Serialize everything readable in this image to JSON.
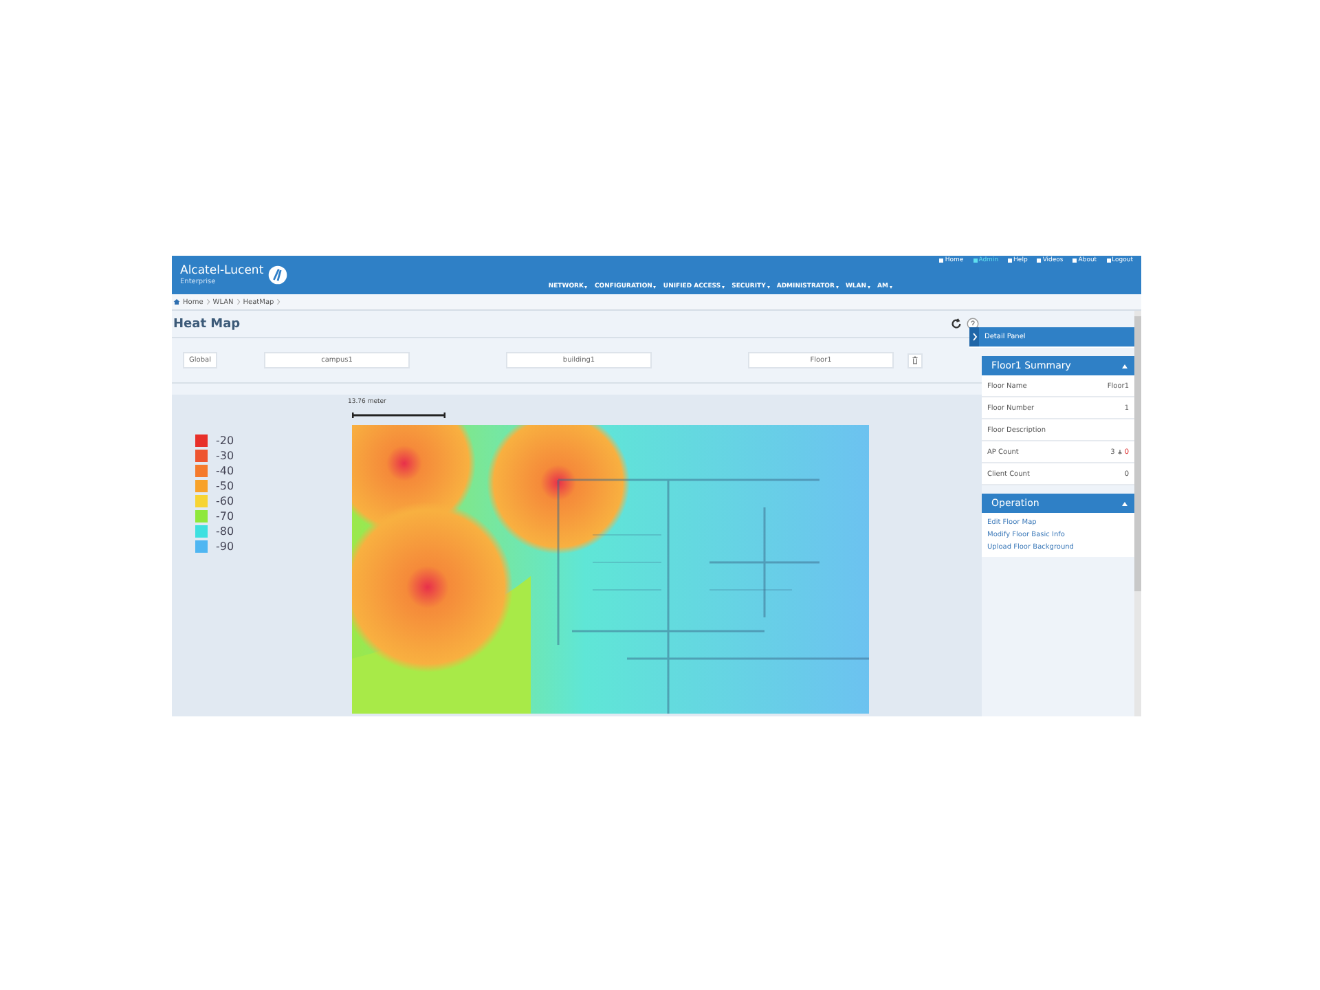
{
  "header": {
    "brand": "Alcatel-Lucent",
    "sub_brand": "Enterprise",
    "top_links": [
      {
        "label": "Home",
        "selected": false
      },
      {
        "label": "Admin",
        "selected": true
      },
      {
        "label": "Help",
        "selected": false
      },
      {
        "label": "Videos",
        "selected": false
      },
      {
        "label": "About",
        "selected": false
      },
      {
        "label": "Logout",
        "selected": false
      }
    ],
    "menu": [
      "NETWORK",
      "CONFIGURATION",
      "UNIFIED ACCESS",
      "SECURITY",
      "ADMINISTRATOR",
      "WLAN",
      "AM"
    ]
  },
  "breadcrumb": [
    "Home",
    "WLAN",
    "HeatMap"
  ],
  "page_title": "Heat Map",
  "filters": {
    "global": "Global",
    "campus": "campus1",
    "building": "building1",
    "floor": "Floor1"
  },
  "scale": {
    "label": "13.76  meter"
  },
  "legend": [
    {
      "label": "-20",
      "color": "#e8302a"
    },
    {
      "label": "-30",
      "color": "#ee5530"
    },
    {
      "label": "-40",
      "color": "#f57a2c"
    },
    {
      "label": "-50",
      "color": "#f8a22a"
    },
    {
      "label": "-60",
      "color": "#f7d433"
    },
    {
      "label": "-70",
      "color": "#8fe83c"
    },
    {
      "label": "-80",
      "color": "#3ee0e0"
    },
    {
      "label": "-90",
      "color": "#4fb6f2"
    }
  ],
  "detail_panel": {
    "title": "Detail Panel",
    "summary": {
      "title": "Floor1 Summary",
      "expanded": true,
      "rows": [
        {
          "label": "Floor Name",
          "value": "Floor1"
        },
        {
          "label": "Floor Number",
          "value": "1"
        },
        {
          "label": "Floor Description"
        },
        {
          "label": "AP Count",
          "value": "3",
          "alert": "0"
        },
        {
          "label": "Client Count",
          "value": "0"
        }
      ]
    },
    "operation": {
      "title": "Operation",
      "expanded": true,
      "links": [
        "Edit Floor Map",
        "Modify Floor Basic Info",
        "Upload Floor Background"
      ]
    }
  }
}
